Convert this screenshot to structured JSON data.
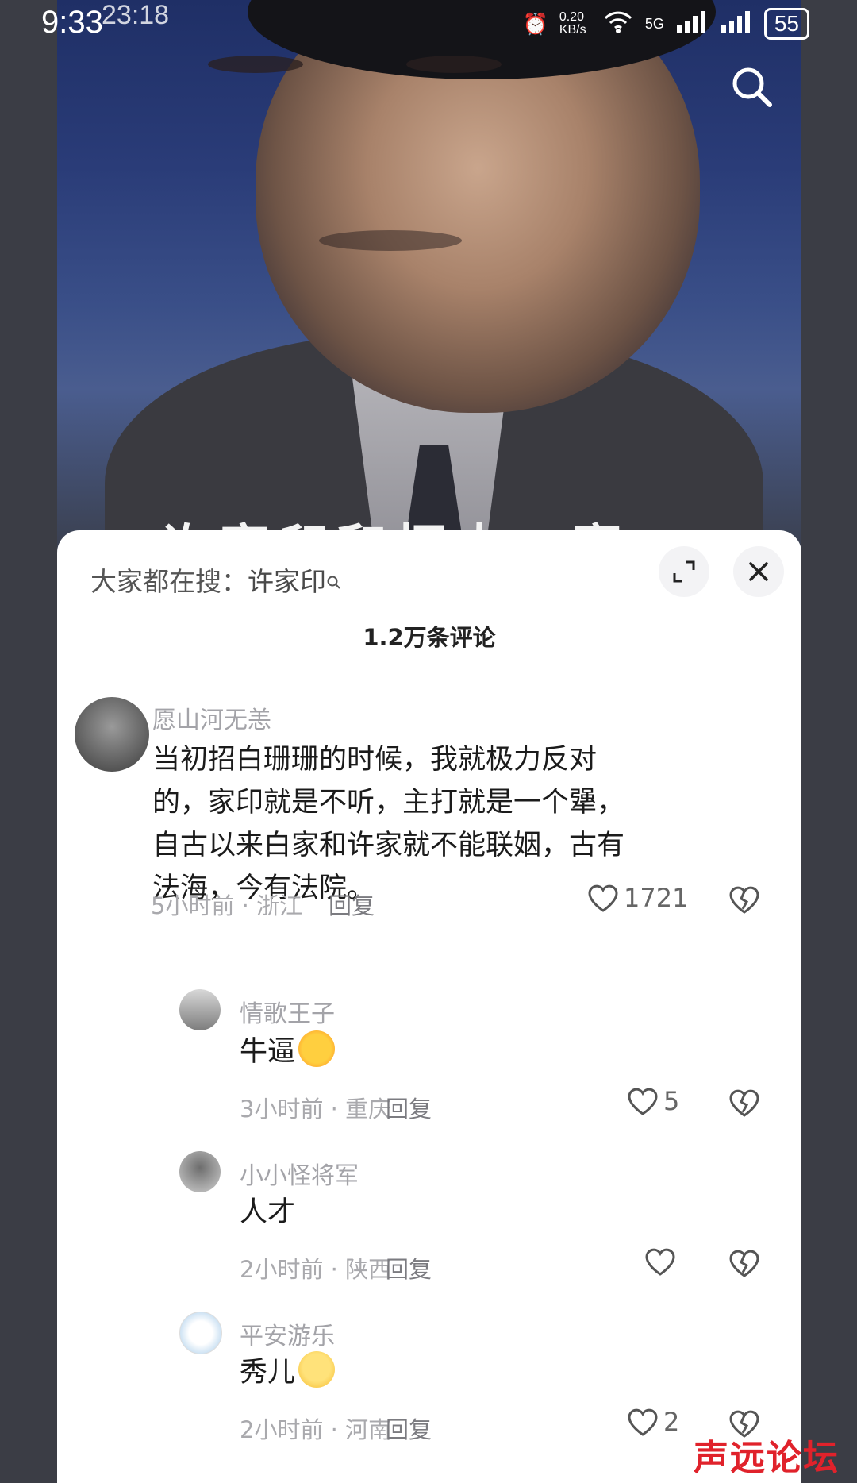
{
  "status_bar": {
    "time": "9:33",
    "overlay_time": "23:18",
    "network_rate": "0.20 KB/s",
    "network_type": "5G",
    "battery": "55"
  },
  "video": {
    "overlay_title": "许家印和恒大…案"
  },
  "comments_panel": {
    "search_prefix": "大家都在搜：",
    "search_keyword": "许家印",
    "comment_count": "1.2万条评论"
  },
  "comments": [
    {
      "user": "愿山河无恙",
      "text": "当初招白珊珊的时候，我就极力反对的，家印就是不听，主打就是一个犟，自古以来白家和许家就不能联姻，古有法海，今有法院。",
      "time": "5小时前",
      "location": "浙江",
      "reply": "回复",
      "likes": "1721"
    },
    {
      "user": "情歌王子",
      "text": "牛逼",
      "emoji": "thumbs-up",
      "time": "3小时前",
      "location": "重庆",
      "reply": "回复",
      "likes": "5"
    },
    {
      "user": "小小怪将军",
      "text": "人才",
      "time": "2小时前",
      "location": "陕西",
      "reply": "回复",
      "likes": ""
    },
    {
      "user": "平安游乐",
      "text": "秀儿",
      "emoji": "blush-face",
      "time": "2小时前",
      "location": "河南",
      "reply": "回复",
      "likes": "2"
    }
  ],
  "meta_separator": "·",
  "watermark": "声远论坛",
  "colors": {
    "sheet_bg": "#ffffff",
    "username": "#a3a3a8",
    "meta": "#a9a9ad",
    "watermark": "#e0222b"
  }
}
